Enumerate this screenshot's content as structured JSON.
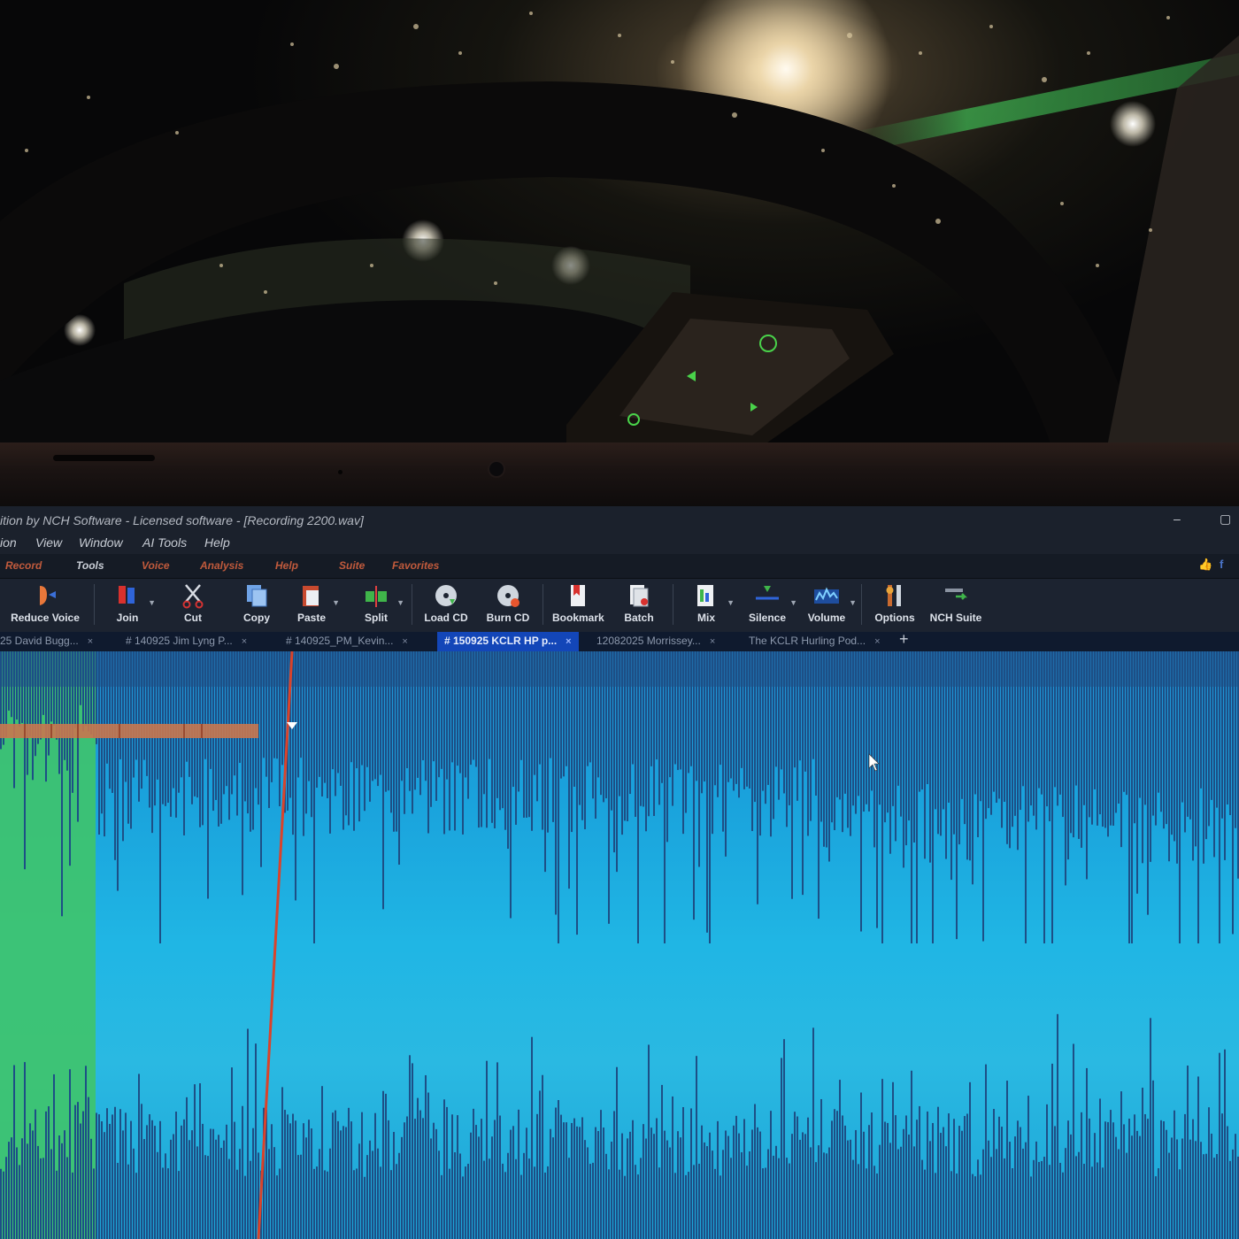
{
  "app": {
    "title": "ition by NCH Software - Licensed software - [Recording 2200.wav]",
    "window_controls": {
      "minimize": "–",
      "maximize": "▢"
    }
  },
  "menu": [
    "ion",
    "View",
    "Window",
    "AI Tools",
    "Help"
  ],
  "ribbon_tabs": [
    "Record",
    "Tools",
    "Voice",
    "Analysis",
    "Help",
    "Suite",
    "Favorites"
  ],
  "toolbar": [
    {
      "label": "Reduce Voice",
      "icon": "reduce-voice-icon",
      "dropdown": false
    },
    {
      "label": "Join",
      "icon": "join-icon",
      "dropdown": true
    },
    {
      "label": "Cut",
      "icon": "scissors-icon",
      "dropdown": false
    },
    {
      "label": "Copy",
      "icon": "copy-icon",
      "dropdown": false
    },
    {
      "label": "Paste",
      "icon": "paste-icon",
      "dropdown": true
    },
    {
      "label": "Split",
      "icon": "split-icon",
      "dropdown": true
    },
    {
      "label": "Load CD",
      "icon": "load-cd-icon",
      "dropdown": false
    },
    {
      "label": "Burn CD",
      "icon": "burn-cd-icon",
      "dropdown": false
    },
    {
      "label": "Bookmark",
      "icon": "bookmark-icon",
      "dropdown": false
    },
    {
      "label": "Batch",
      "icon": "batch-icon",
      "dropdown": false
    },
    {
      "label": "Mix",
      "icon": "mix-icon",
      "dropdown": true
    },
    {
      "label": "Silence",
      "icon": "silence-icon",
      "dropdown": true
    },
    {
      "label": "Volume",
      "icon": "volume-icon",
      "dropdown": true
    },
    {
      "label": "Options",
      "icon": "options-icon",
      "dropdown": false
    },
    {
      "label": "NCH Suite",
      "icon": "nch-suite-icon",
      "dropdown": false
    }
  ],
  "file_tabs": [
    {
      "label": "25 David Bugg...",
      "active": false
    },
    {
      "label": "# 140925 Jim Lyng P...",
      "active": false
    },
    {
      "label": "# 140925_PM_Kevin...",
      "active": false
    },
    {
      "label": "# 150925 KCLR HP p...",
      "active": true
    },
    {
      "label": "12082025 Morrissey...",
      "active": false
    },
    {
      "label": "The KCLR Hurling Pod...",
      "active": false
    }
  ],
  "file_tab_close": "×",
  "new_tab": "+",
  "colors": {
    "waveform": "#1d4f86",
    "waveform_background": "#1fa8de",
    "selection": "#3fc46a",
    "playhead": "#d9432b",
    "active_tab": "#1346b8"
  }
}
